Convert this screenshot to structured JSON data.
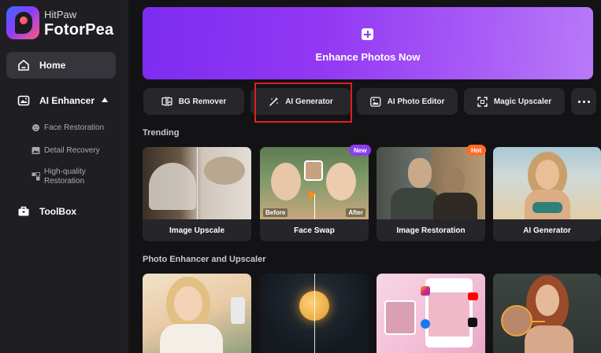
{
  "app": {
    "brand_top": "HitPaw",
    "brand_main": "FotorPea"
  },
  "sidebar": {
    "home": "Home",
    "ai_enhancer": "AI Enhancer",
    "sub_items": [
      {
        "label": "Face Restoration",
        "icon": "face-icon"
      },
      {
        "label": "Detail Recovery",
        "icon": "image-icon"
      },
      {
        "label": "High-quality",
        "label2": "Restoration",
        "icon": "grid-icon"
      }
    ],
    "toolbox": "ToolBox"
  },
  "hero": {
    "label": "Enhance Photos Now",
    "icon": "plus-icon"
  },
  "tools": [
    {
      "label": "BG Remover",
      "icon": "bg-remover-icon"
    },
    {
      "label": "AI Generator",
      "icon": "magic-wand-icon"
    },
    {
      "label": "AI Photo Editor",
      "icon": "photo-editor-icon"
    },
    {
      "label": "Magic Upscaler",
      "icon": "expand-icon"
    }
  ],
  "sections": {
    "trending": "Trending",
    "enhancer": "Photo Enhancer and Upscaler"
  },
  "trending_cards": [
    {
      "label": "Image Upscale"
    },
    {
      "label": "Face Swap",
      "badge": "New",
      "before": "Before",
      "after": "After"
    },
    {
      "label": "Image Restoration",
      "badge": "Hot"
    },
    {
      "label": "AI Generator"
    }
  ],
  "colors": {
    "accent": "#8a3bf2",
    "badge_new": "#8b3df0",
    "badge_hot": "#ff6a2b",
    "highlight": "#e02020",
    "sidebar_bg": "#1f1f23",
    "main_bg": "#131316"
  }
}
